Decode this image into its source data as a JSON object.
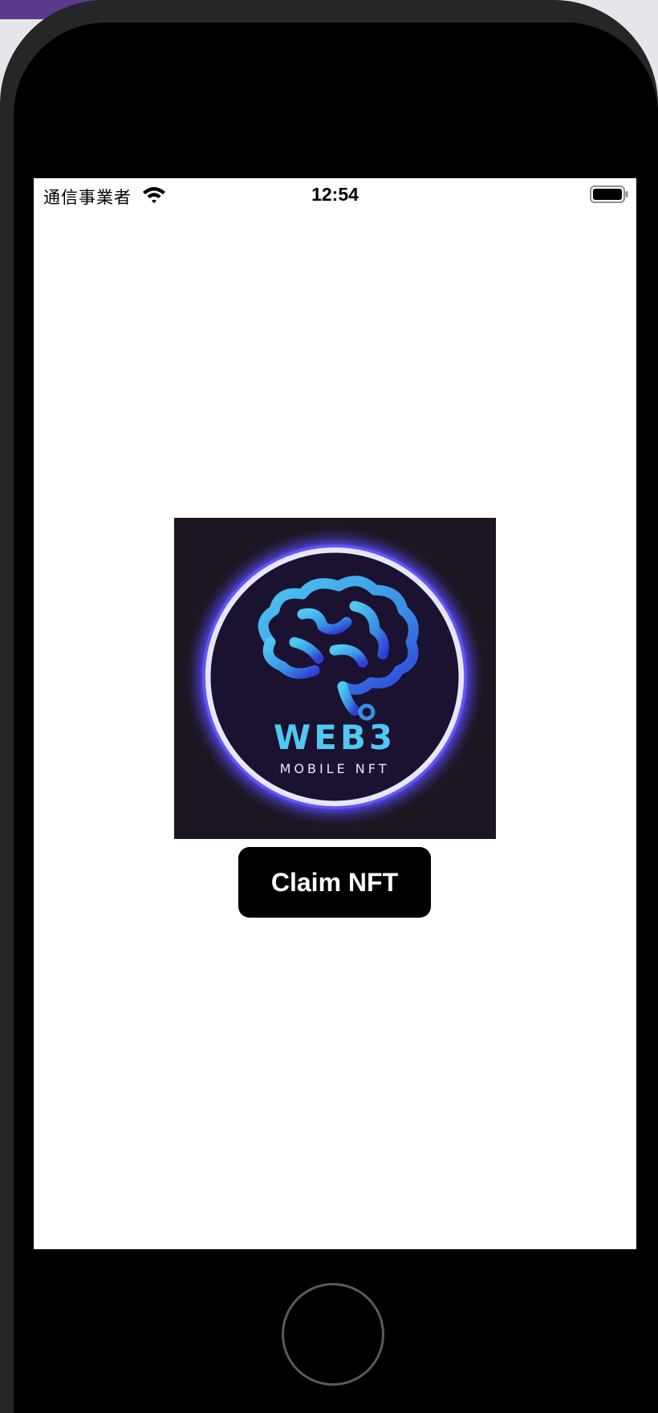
{
  "status_bar": {
    "carrier": "通信事業者",
    "time": "12:54",
    "wifi_icon": "wifi-icon",
    "battery_icon": "battery-icon"
  },
  "nft": {
    "image_icon": "web3-brain-logo",
    "logo_title": "WEB3",
    "logo_subtitle": "MOBILE NFT"
  },
  "claim_button": {
    "label": "Claim NFT"
  },
  "device": {
    "home_button_icon": "home-button-icon"
  },
  "colors": {
    "button_bg": "#000000",
    "button_text": "#ffffff",
    "logo_cyan": "#4fc9f0",
    "logo_ring": "#e8e6ff",
    "logo_bg": "#1d1520"
  }
}
